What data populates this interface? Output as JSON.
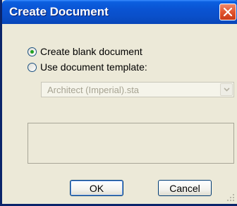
{
  "window": {
    "title": "Create Document",
    "close_icon": "close-icon",
    "colors": {
      "titlebar": "#0a53d2",
      "close": "#e2552f",
      "body": "#ece9d8",
      "radio_dot": "#21a121"
    }
  },
  "options": {
    "blank_label": "Create blank document",
    "template_label": "Use document template:",
    "selected": "blank"
  },
  "template_select": {
    "value": "Architect (Imperial).sta",
    "enabled": false
  },
  "buttons": {
    "ok_label": "OK",
    "cancel_label": "Cancel"
  }
}
